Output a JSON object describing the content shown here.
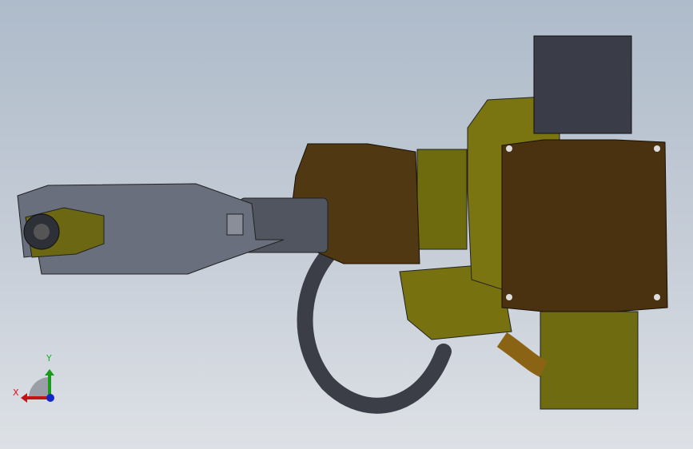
{
  "triad": {
    "x_label": "X",
    "y_label": "Y",
    "colors": {
      "x": "#c0141a",
      "y": "#1a9a1a",
      "z": "#1428c8"
    }
  },
  "model": {
    "colors": {
      "olive": "#77720f",
      "brown": "#4a3110",
      "gray": "#6a6f7e",
      "hose": "#3b3e46",
      "motor": "#3a3d48"
    }
  }
}
